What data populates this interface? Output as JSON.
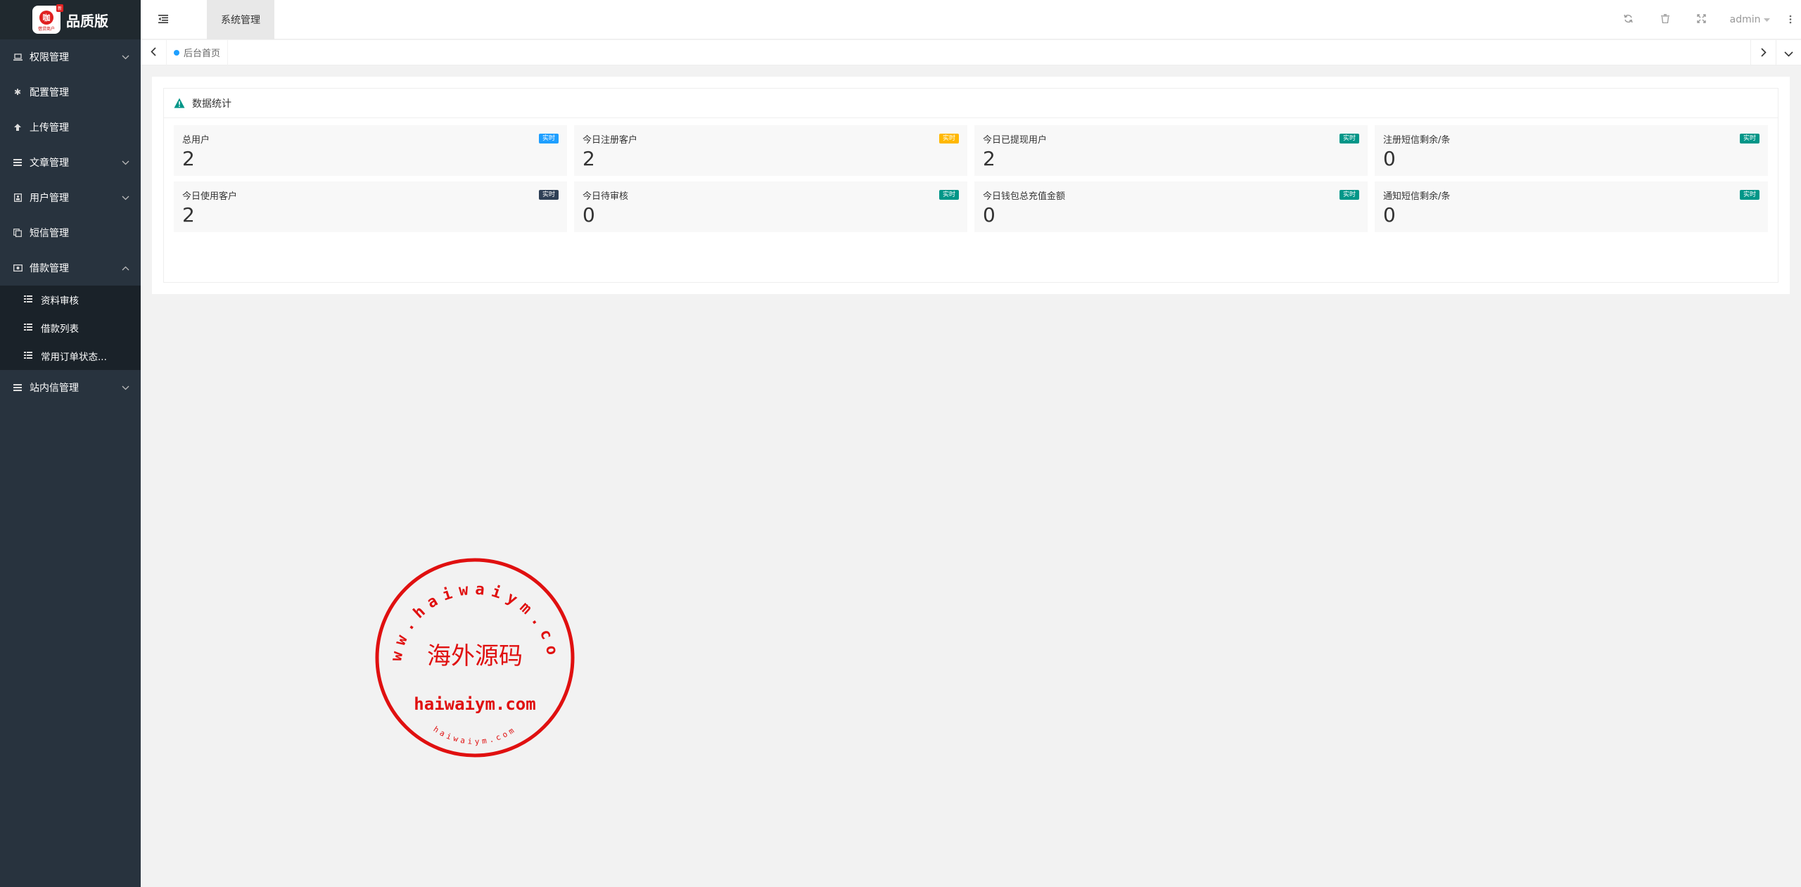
{
  "app": {
    "logo_badge_text": "新",
    "logo_circle_text": "咖",
    "logo_small_text": "借贷商户",
    "brand": "品质版"
  },
  "sidebar": {
    "items": [
      {
        "label": "权限管理",
        "icon": "laptop-icon",
        "expandable": true,
        "expanded": false
      },
      {
        "label": "配置管理",
        "icon": "gear-icon",
        "expandable": false
      },
      {
        "label": "上传管理",
        "icon": "arrow-up-icon",
        "expandable": false
      },
      {
        "label": "文章管理",
        "icon": "list-icon",
        "expandable": true,
        "expanded": false
      },
      {
        "label": "用户管理",
        "icon": "user-card-icon",
        "expandable": true,
        "expanded": false
      },
      {
        "label": "短信管理",
        "icon": "copy-icon",
        "expandable": false
      },
      {
        "label": "借款管理",
        "icon": "money-icon",
        "expandable": true,
        "expanded": true
      },
      {
        "label": "站内信管理",
        "icon": "list-icon",
        "expandable": true,
        "expanded": false
      }
    ],
    "loan_subitems": [
      {
        "label": "资料审核"
      },
      {
        "label": "借款列表"
      },
      {
        "label": "常用订单状态..."
      }
    ]
  },
  "header": {
    "tab_label": "系统管理",
    "user": "admin"
  },
  "tabbar": {
    "active_tab": "后台首页"
  },
  "stats_card": {
    "title": "数据统计",
    "items": [
      {
        "label": "总用户",
        "value": "2",
        "badge": "实时",
        "badge_color": "#1e9fff"
      },
      {
        "label": "今日注册客户",
        "value": "2",
        "badge": "实时",
        "badge_color": "#ffb800"
      },
      {
        "label": "今日已提现用户",
        "value": "2",
        "badge": "实时",
        "badge_color": "#009688"
      },
      {
        "label": "注册短信剩余/条",
        "value": "0",
        "badge": "实时",
        "badge_color": "#009688"
      },
      {
        "label": "今日使用客户",
        "value": "2",
        "badge": "实时",
        "badge_color": "#2f4056"
      },
      {
        "label": "今日待审核",
        "value": "0",
        "badge": "实时",
        "badge_color": "#009688"
      },
      {
        "label": "今日钱包总充值金额",
        "value": "0",
        "badge": "实时",
        "badge_color": "#009688"
      },
      {
        "label": "通知短信剩余/条",
        "value": "0",
        "badge": "实时",
        "badge_color": "#009688"
      }
    ]
  },
  "watermark": {
    "outer_text": "www.haiwaiym.com",
    "center_text": "海外源码",
    "domain_text": "haiwaiym.com",
    "bottom_text": "haiwaiym.com"
  }
}
